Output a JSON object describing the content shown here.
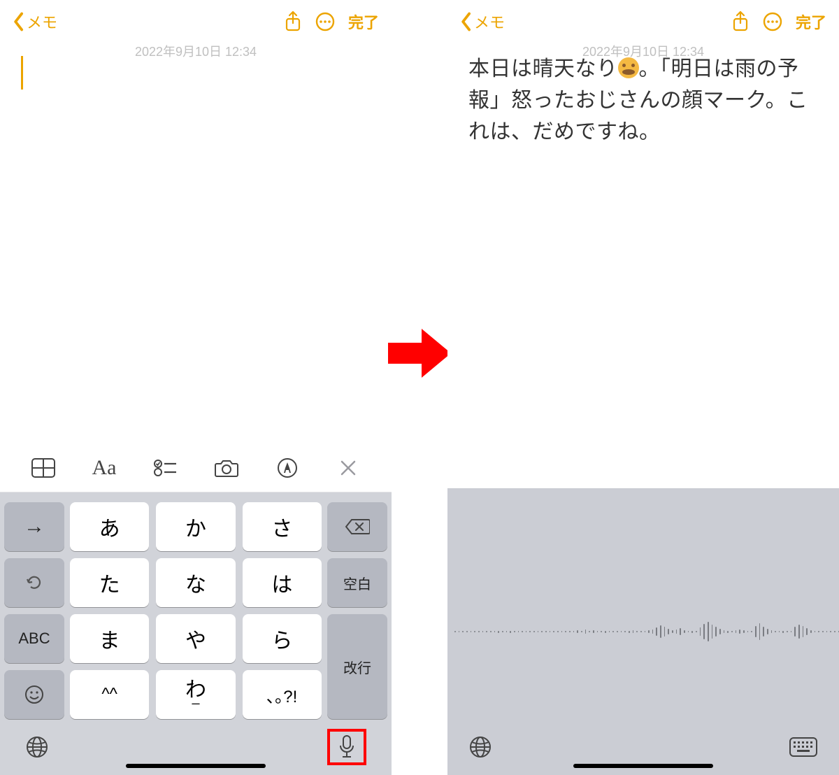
{
  "colors": {
    "accent": "#ECA400",
    "highlight": "#FF0000",
    "kb_bg": "#D1D3D9"
  },
  "nav": {
    "back_label": "メモ",
    "done_label": "完了",
    "timestamp_left": "2022年9月10日 12:34",
    "timestamp_right": "2022年9月10日 12:34"
  },
  "note": {
    "left_body": "",
    "right_body_before_emoji": "本日は晴天なり",
    "right_body_after_emoji": "。「明日は雨の予報」怒ったおじさんの顔マーク。これは、だめですね。"
  },
  "toolbar": {
    "icons": [
      "table-icon",
      "text-style-icon",
      "checklist-icon",
      "camera-icon",
      "markup-icon",
      "close-icon"
    ],
    "aa_label": "Aa"
  },
  "keyboard": {
    "side_left": {
      "arrow_right": "→",
      "undo": "undo",
      "abc": "ABC",
      "emoji": "emoji"
    },
    "main_rows": [
      [
        "あ",
        "か",
        "さ"
      ],
      [
        "た",
        "な",
        "は"
      ],
      [
        "ま",
        "や",
        "ら"
      ],
      [
        "^^",
        "わ",
        "､｡?!"
      ]
    ],
    "side_right": {
      "backspace": "backspace",
      "space": "空白",
      "return": "改行"
    }
  },
  "bottom": {
    "globe_label": "globe-icon",
    "mic_label": "mic-icon",
    "keyboard_label": "keyboard-icon"
  },
  "waveform_heights": [
    2,
    2,
    2,
    2,
    2,
    2,
    2,
    2,
    2,
    2,
    2,
    3,
    2,
    2,
    3,
    2,
    2,
    2,
    2,
    2,
    2,
    2,
    2,
    2,
    2,
    2,
    2,
    2,
    2,
    2,
    2,
    4,
    2,
    6,
    2,
    4,
    2,
    2,
    3,
    2,
    2,
    2,
    2,
    2,
    3,
    4,
    2,
    2,
    2,
    4,
    6,
    12,
    18,
    14,
    8,
    4,
    6,
    10,
    4,
    2,
    3,
    2,
    12,
    22,
    28,
    20,
    14,
    8,
    4,
    3,
    2,
    4,
    6,
    4,
    2,
    2,
    16,
    24,
    14,
    8,
    4,
    2,
    2,
    3,
    2,
    2,
    14,
    20,
    16,
    10,
    4,
    2,
    2,
    2,
    2,
    2,
    2,
    2
  ]
}
